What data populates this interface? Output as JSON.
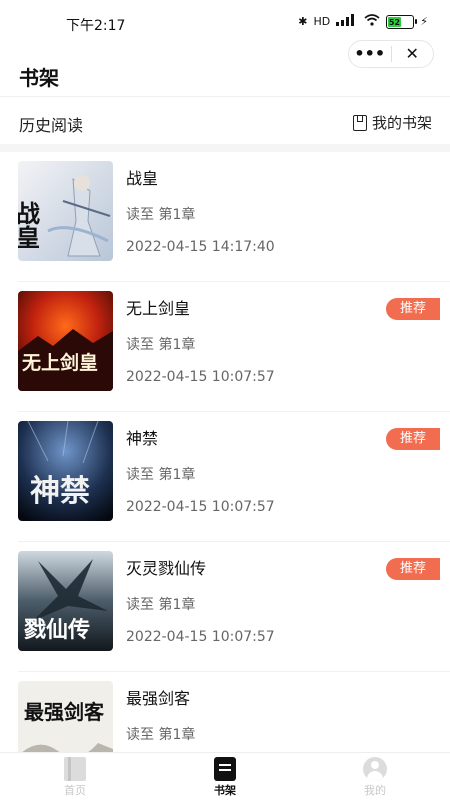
{
  "status_bar": {
    "time": "下午2:17",
    "bluetooth": "✱",
    "network": "HD",
    "signal": "📶",
    "battery_level": "52",
    "charging": "⚡"
  },
  "capsule": {
    "more": "•••",
    "close": "✕"
  },
  "header": {
    "title": "书架"
  },
  "section": {
    "title": "历史阅读",
    "my_shelf_label": "我的书架"
  },
  "books": [
    {
      "title": "战皇",
      "progress": "读至 第1章",
      "time": "2022-04-15 14:17:40",
      "badge": "",
      "cover_text": "战皇"
    },
    {
      "title": "无上剑皇",
      "progress": "读至 第1章",
      "time": "2022-04-15 10:07:57",
      "badge": "推荐",
      "cover_text": "无上剑皇"
    },
    {
      "title": "神禁",
      "progress": "读至 第1章",
      "time": "2022-04-15 10:07:57",
      "badge": "推荐",
      "cover_text": "神禁"
    },
    {
      "title": "灭灵戮仙传",
      "progress": "读至 第1章",
      "time": "2022-04-15 10:07:57",
      "badge": "推荐",
      "cover_text": "戮仙传"
    },
    {
      "title": "最强剑客",
      "progress": "读至 第1章",
      "time": "",
      "badge": "",
      "cover_text": "最强剑客"
    }
  ],
  "tabs": [
    {
      "label": "首页",
      "icon": "home-icon",
      "active": false
    },
    {
      "label": "书架",
      "icon": "bookshelf-icon",
      "active": true
    },
    {
      "label": "我的",
      "icon": "user-icon",
      "active": false
    }
  ],
  "colors": {
    "accent": "#f26d4f",
    "active_tab": "#111111",
    "inactive_tab": "#c8c8c8"
  }
}
